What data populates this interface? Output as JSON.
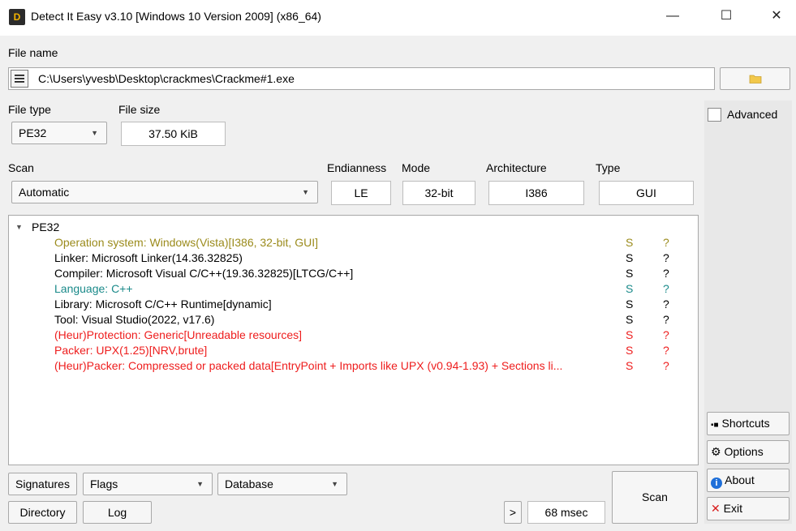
{
  "window": {
    "title": "Detect It Easy v3.10 [Windows 10 Version 2009] (x86_64)",
    "icon_text": "D",
    "minimize_glyph": "—",
    "maximize_glyph": "☐",
    "close_glyph": "✕"
  },
  "file": {
    "label": "File name",
    "path": "C:\\Users\\yvesb\\Desktop\\crackmes\\Crackme#1.exe"
  },
  "file_type": {
    "label": "File type",
    "value": "PE32"
  },
  "file_size": {
    "label": "File size",
    "value": "37.50 KiB"
  },
  "scan": {
    "label": "Scan",
    "mode_value": "Automatic",
    "endianness_label": "Endianness",
    "endianness_value": "LE",
    "mode_label": "Mode",
    "mode_bits": "32-bit",
    "architecture_label": "Architecture",
    "architecture_value": "I386",
    "type_label": "Type",
    "type_value": "GUI"
  },
  "results": {
    "root": "PE32",
    "rows": [
      {
        "text": "Operation system: Windows(Vista)[I386, 32-bit, GUI]",
        "s": "S",
        "q": "?",
        "color": "#9b8b1c"
      },
      {
        "text": "Linker: Microsoft Linker(14.36.32825)",
        "s": "S",
        "q": "?",
        "color": "#000000"
      },
      {
        "text": "Compiler: Microsoft Visual C/C++(19.36.32825)[LTCG/C++]",
        "s": "S",
        "q": "?",
        "color": "#000000"
      },
      {
        "text": "Language: C++",
        "s": "S",
        "q": "?",
        "color": "#1a8a8a"
      },
      {
        "text": "Library: Microsoft C/C++ Runtime[dynamic]",
        "s": "S",
        "q": "?",
        "color": "#000000"
      },
      {
        "text": "Tool: Visual Studio(2022, v17.6)",
        "s": "S",
        "q": "?",
        "color": "#000000"
      },
      {
        "text": "(Heur)Protection: Generic[Unreadable resources]",
        "s": "S",
        "q": "?",
        "color": "#ee1d1d"
      },
      {
        "text": "Packer: UPX(1.25)[NRV,brute]",
        "s": "S",
        "q": "?",
        "color": "#ee1d1d"
      },
      {
        "text": "(Heur)Packer: Compressed or packed data[EntryPoint + Imports like UPX (v0.94-1.93) + Sections li...",
        "s": "S",
        "q": "?",
        "color": "#ee1d1d"
      }
    ]
  },
  "advanced_label": "Advanced",
  "side_buttons": {
    "shortcuts": "Shortcuts",
    "options": "Options",
    "about": "About",
    "exit": "Exit"
  },
  "bottom": {
    "signatures": "Signatures",
    "flags": "Flags",
    "database": "Database",
    "directory": "Directory",
    "log": "Log",
    "more": ">",
    "time": "68 msec",
    "scan": "Scan"
  }
}
